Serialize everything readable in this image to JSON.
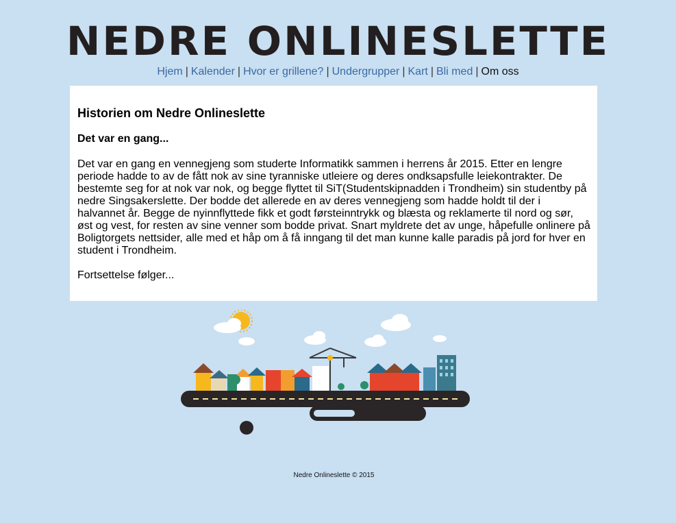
{
  "site": {
    "title": "NEDRE ONLINESLETTE"
  },
  "nav": {
    "items": [
      {
        "label": "Hjem"
      },
      {
        "label": "Kalender"
      },
      {
        "label": "Hvor er grillene?"
      },
      {
        "label": "Undergrupper"
      },
      {
        "label": "Kart"
      },
      {
        "label": "Bli med"
      }
    ],
    "current": "Om oss",
    "separator": "|"
  },
  "content": {
    "heading": "Historien om Nedre Onlineslette",
    "subheading": "Det var en gang...",
    "body": "Det var en gang en vennegjeng som studerte Informatikk sammen i herrens år 2015. Etter en lengre periode hadde to av de fått nok av sine tyranniske utleiere og deres ondksapsfulle leiekontrakter. De bestemte seg for at nok var nok, og begge flyttet til SiT(Studentskipnadden i Trondheim) sin studentby på nedre Singsakerslette. Der bodde det allerede en av deres vennegjeng som hadde holdt til der i halvannet år. Begge de nyinnflyttede fikk et godt førsteinntrykk og blæsta og reklamerte til nord og sør, øst og vest, for resten av sine venner som bodde privat. Snart myldrete det av unge, håpefulle onlinere på Boligtorgets nettsider, alle med et håp om å få inngang til det man kunne kalle paradis på jord for hver en student i Trondheim.",
    "continuation": "Fortsettelse følger..."
  },
  "illustration": {
    "icon": "city-illustration-icon"
  },
  "footer": {
    "text": "Nedre Onlineslette © 2015"
  },
  "colors": {
    "background": "#c9dff2",
    "link": "#3a6aa2",
    "title": "#231f20"
  }
}
